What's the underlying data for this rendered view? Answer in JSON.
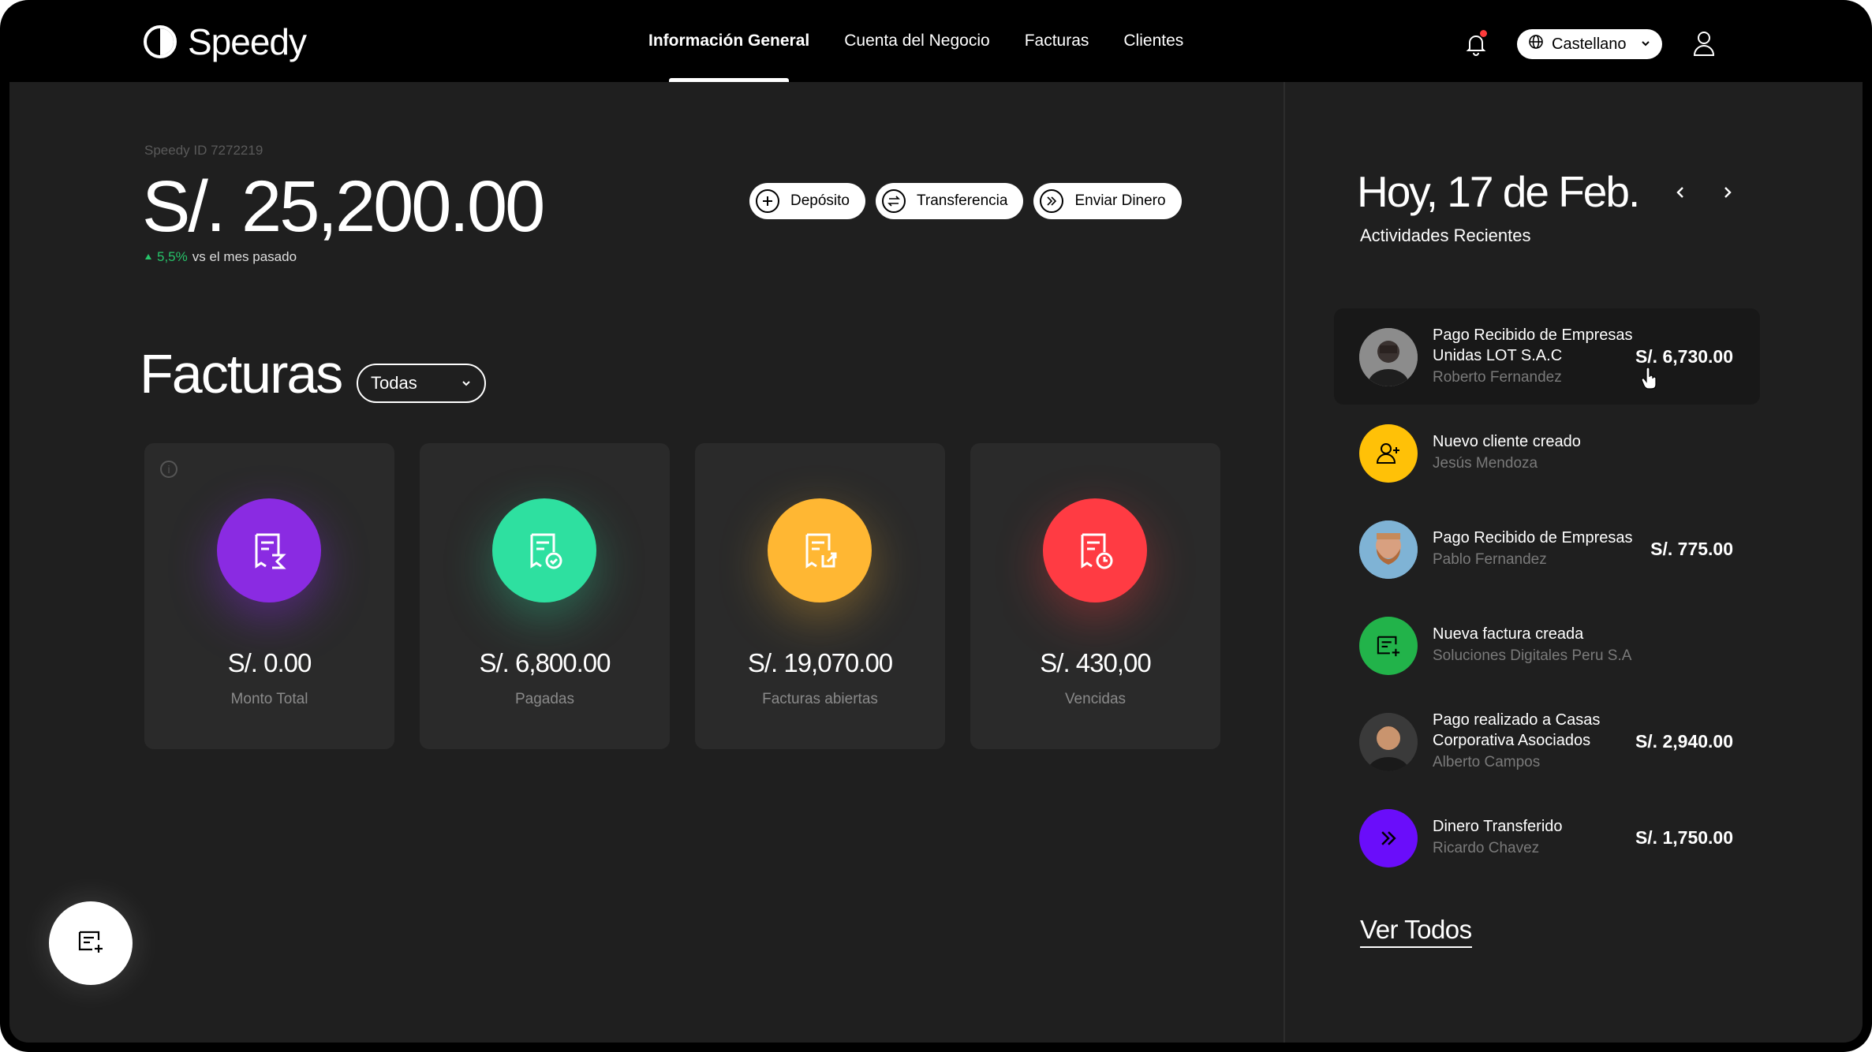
{
  "app": {
    "name": "Speedy"
  },
  "nav": {
    "items": [
      {
        "label": "Información General",
        "active": true
      },
      {
        "label": "Cuenta del Negocio"
      },
      {
        "label": "Facturas"
      },
      {
        "label": "Clientes"
      }
    ]
  },
  "header": {
    "language": "Castellano"
  },
  "account": {
    "id_label": "Speedy ID 7272219",
    "balance": "S/. 25,200.00",
    "delta_pct": "5,5%",
    "delta_text": "vs el mes pasado"
  },
  "actions": {
    "deposit": "Depósito",
    "transfer": "Transferencia",
    "send": "Enviar Dinero"
  },
  "invoices": {
    "title": "Facturas",
    "filter": "Todas",
    "cards": [
      {
        "amount": "S/. 0.00",
        "label": "Monto Total",
        "color": "#8a2be2",
        "icon": "invoice-sum-icon"
      },
      {
        "amount": "S/. 6,800.00",
        "label": "Pagadas",
        "color": "#2ee0a0",
        "icon": "invoice-check-icon"
      },
      {
        "amount": "S/. 19,070.00",
        "label": "Facturas abiertas",
        "color": "#ffb733",
        "icon": "invoice-open-icon"
      },
      {
        "amount": "S/. 430,00",
        "label": "Vencidas",
        "color": "#ff3b43",
        "icon": "invoice-clock-icon"
      }
    ]
  },
  "recent": {
    "date_title": "Hoy, 17 de Feb.",
    "subtitle": "Actividades Recientes",
    "see_all": "Ver Todos",
    "items": [
      {
        "title": "Pago Recibido de Empresas Unidas LOT S.A.C",
        "person": "Roberto Fernandez",
        "amount": "S/. 6,730.00",
        "avatar": "photo"
      },
      {
        "title": "Nuevo cliente creado",
        "person": "Jesús Mendoza",
        "amount": "",
        "avatar": "user-plus-icon",
        "color": "#ffc107"
      },
      {
        "title": "Pago Recibido de Empresas",
        "person": "Pablo Fernandez",
        "amount": "S/. 775.00",
        "avatar": "photo"
      },
      {
        "title": "Nueva factura creada",
        "person": "Soluciones Digitales Peru S.A",
        "amount": "",
        "avatar": "invoice-add-icon",
        "color": "#22b34a"
      },
      {
        "title": "Pago realizado a Casas Corporativa Asociados",
        "person": "Alberto Campos",
        "amount": "S/. 2,940.00",
        "avatar": "photo"
      },
      {
        "title": "Dinero Transferido",
        "person": "Ricardo Chavez",
        "amount": "S/. 1,750.00",
        "avatar": "double-chevron-icon",
        "color": "#6a0dfa"
      }
    ]
  }
}
